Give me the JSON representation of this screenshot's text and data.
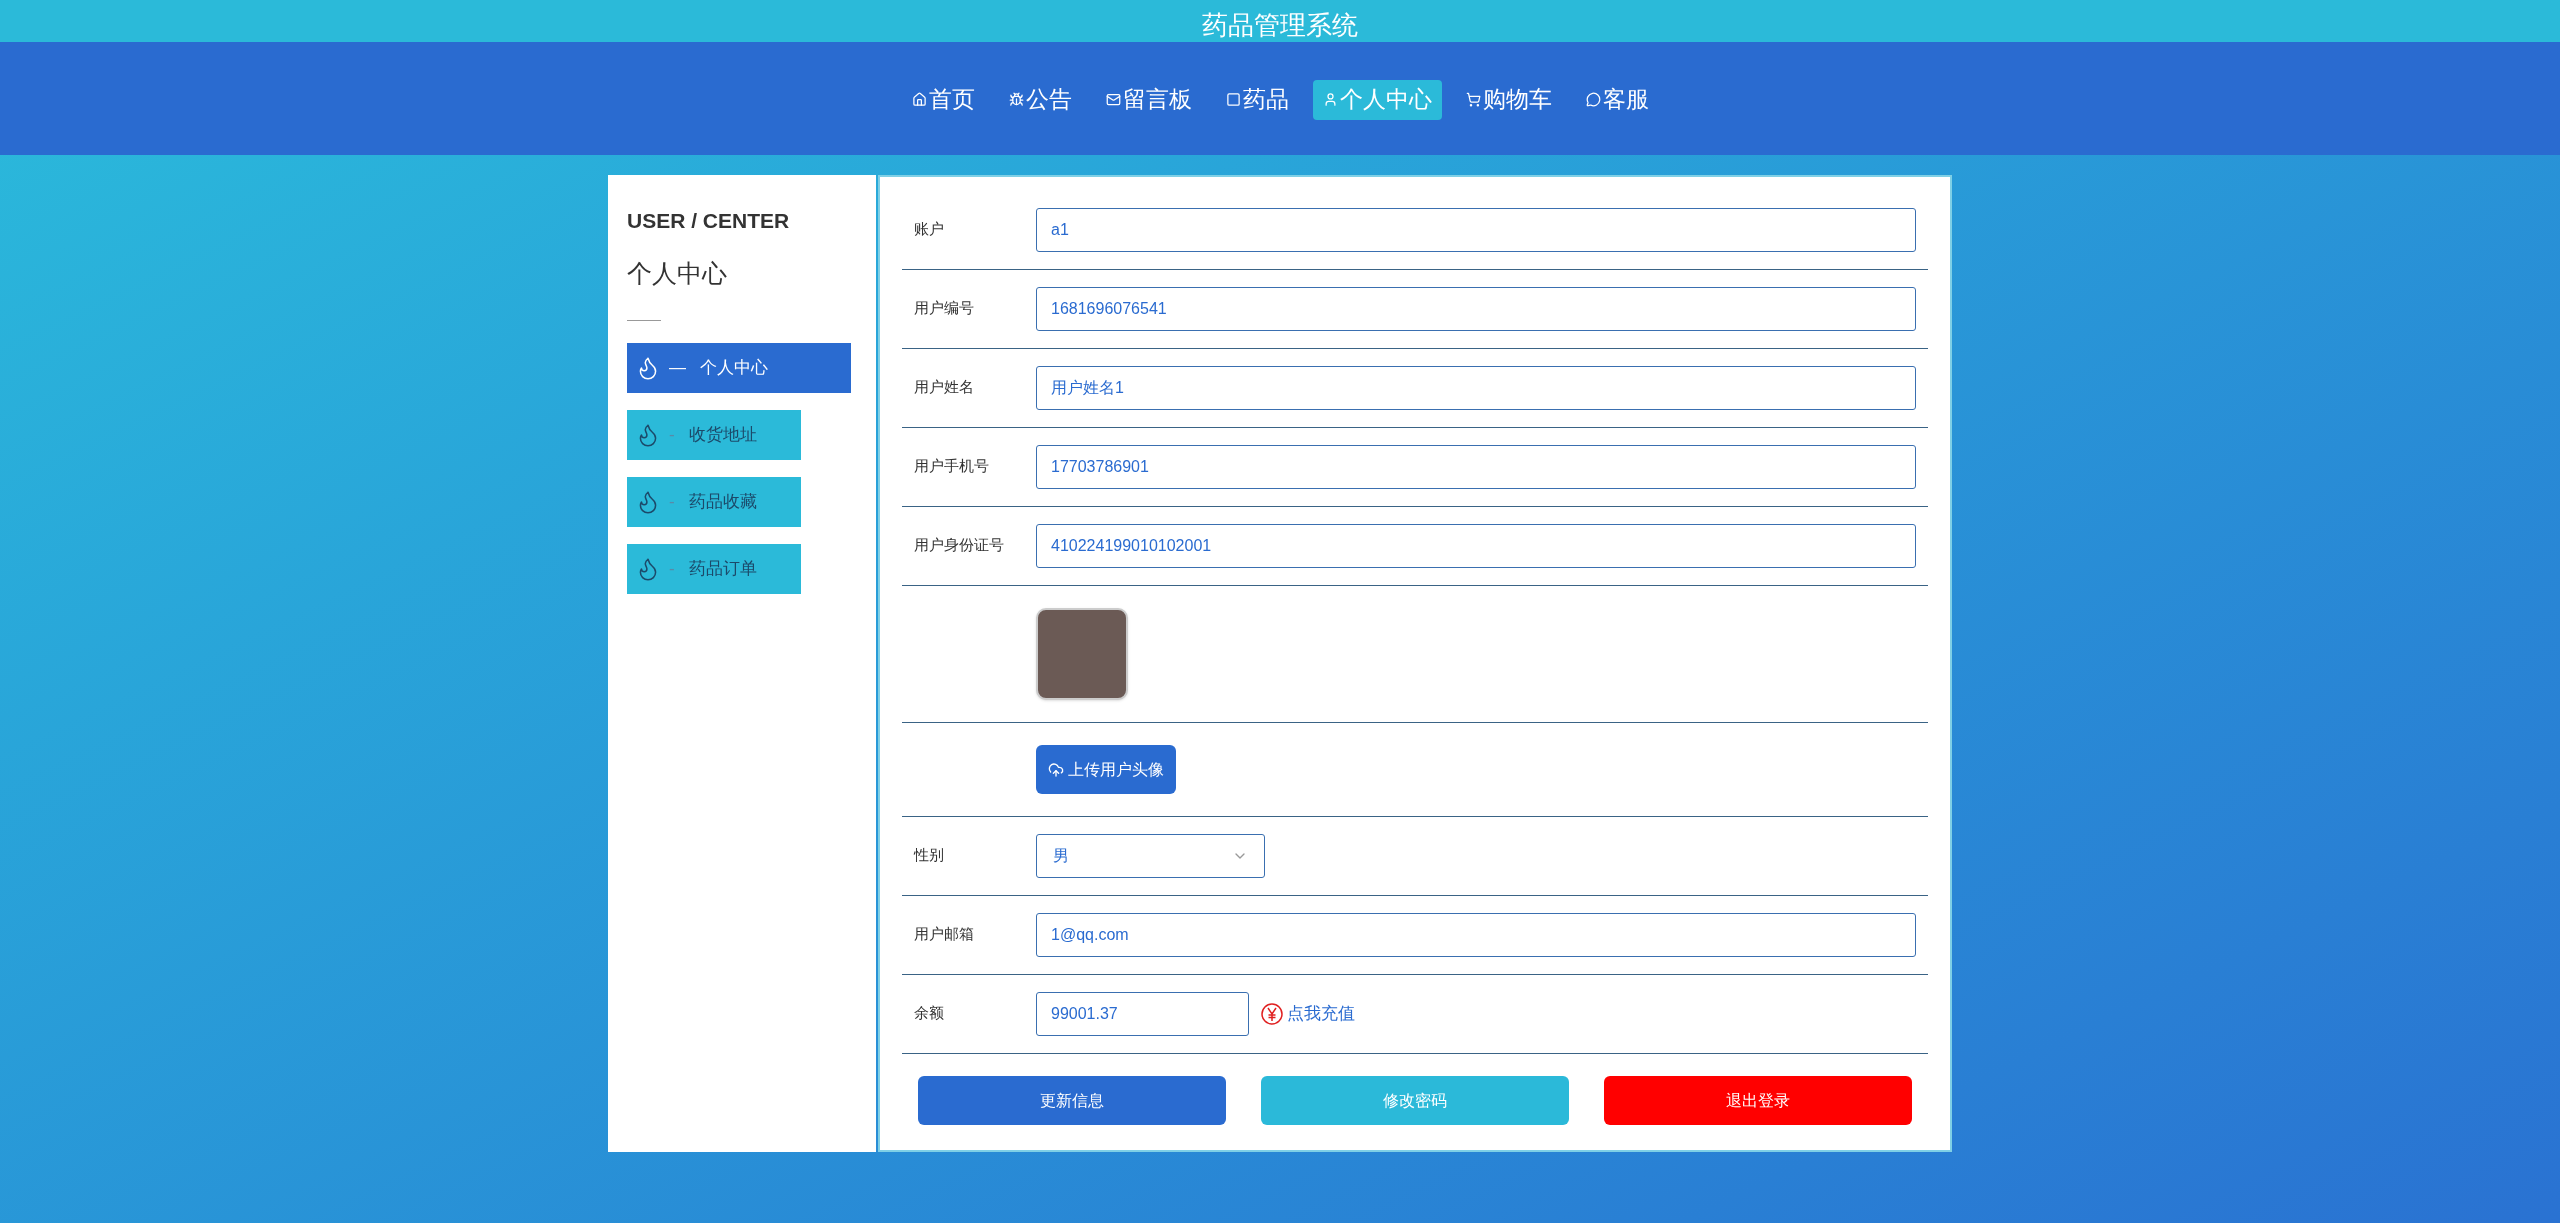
{
  "header": {
    "title": "药品管理系统"
  },
  "nav": [
    {
      "label": "首页",
      "selected": false
    },
    {
      "label": "公告",
      "selected": false
    },
    {
      "label": "留言板",
      "selected": false
    },
    {
      "label": "药品",
      "selected": false
    },
    {
      "label": "个人中心",
      "selected": true
    },
    {
      "label": "购物车",
      "selected": false
    },
    {
      "label": "客服",
      "selected": false
    }
  ],
  "sidebar": {
    "heading_en": "USER / CENTER",
    "heading": "个人中心",
    "items": [
      {
        "label": "个人中心",
        "marker": "—",
        "selected": true
      },
      {
        "label": "收货地址",
        "marker": "-",
        "selected": false
      },
      {
        "label": "药品收藏",
        "marker": "-",
        "selected": false
      },
      {
        "label": "药品订单",
        "marker": "-",
        "selected": false
      }
    ]
  },
  "form": {
    "fields": [
      {
        "kind": "text",
        "label": "账户",
        "value": "a1"
      },
      {
        "kind": "text",
        "label": "用户编号",
        "value": "1681696076541"
      },
      {
        "kind": "text",
        "label": "用户姓名",
        "value": "用户姓名1"
      },
      {
        "kind": "text",
        "label": "用户手机号",
        "value": "17703786901"
      },
      {
        "kind": "text",
        "label": "用户身份证号",
        "value": "410224199010102001"
      },
      {
        "kind": "avatar"
      },
      {
        "kind": "upload",
        "button": "上传用户头像"
      },
      {
        "kind": "select",
        "label": "性别",
        "value": "男"
      },
      {
        "kind": "text",
        "label": "用户邮箱",
        "value": "1@qq.com"
      },
      {
        "kind": "balance",
        "label": "余额",
        "value": "99001.37",
        "link": "点我充值"
      }
    ],
    "buttons": [
      {
        "label": "更新信息",
        "color": "#2a6bd0"
      },
      {
        "label": "修改密码",
        "color": "#2bb9d9"
      },
      {
        "label": "退出登录",
        "color": "#ff0000"
      }
    ]
  }
}
